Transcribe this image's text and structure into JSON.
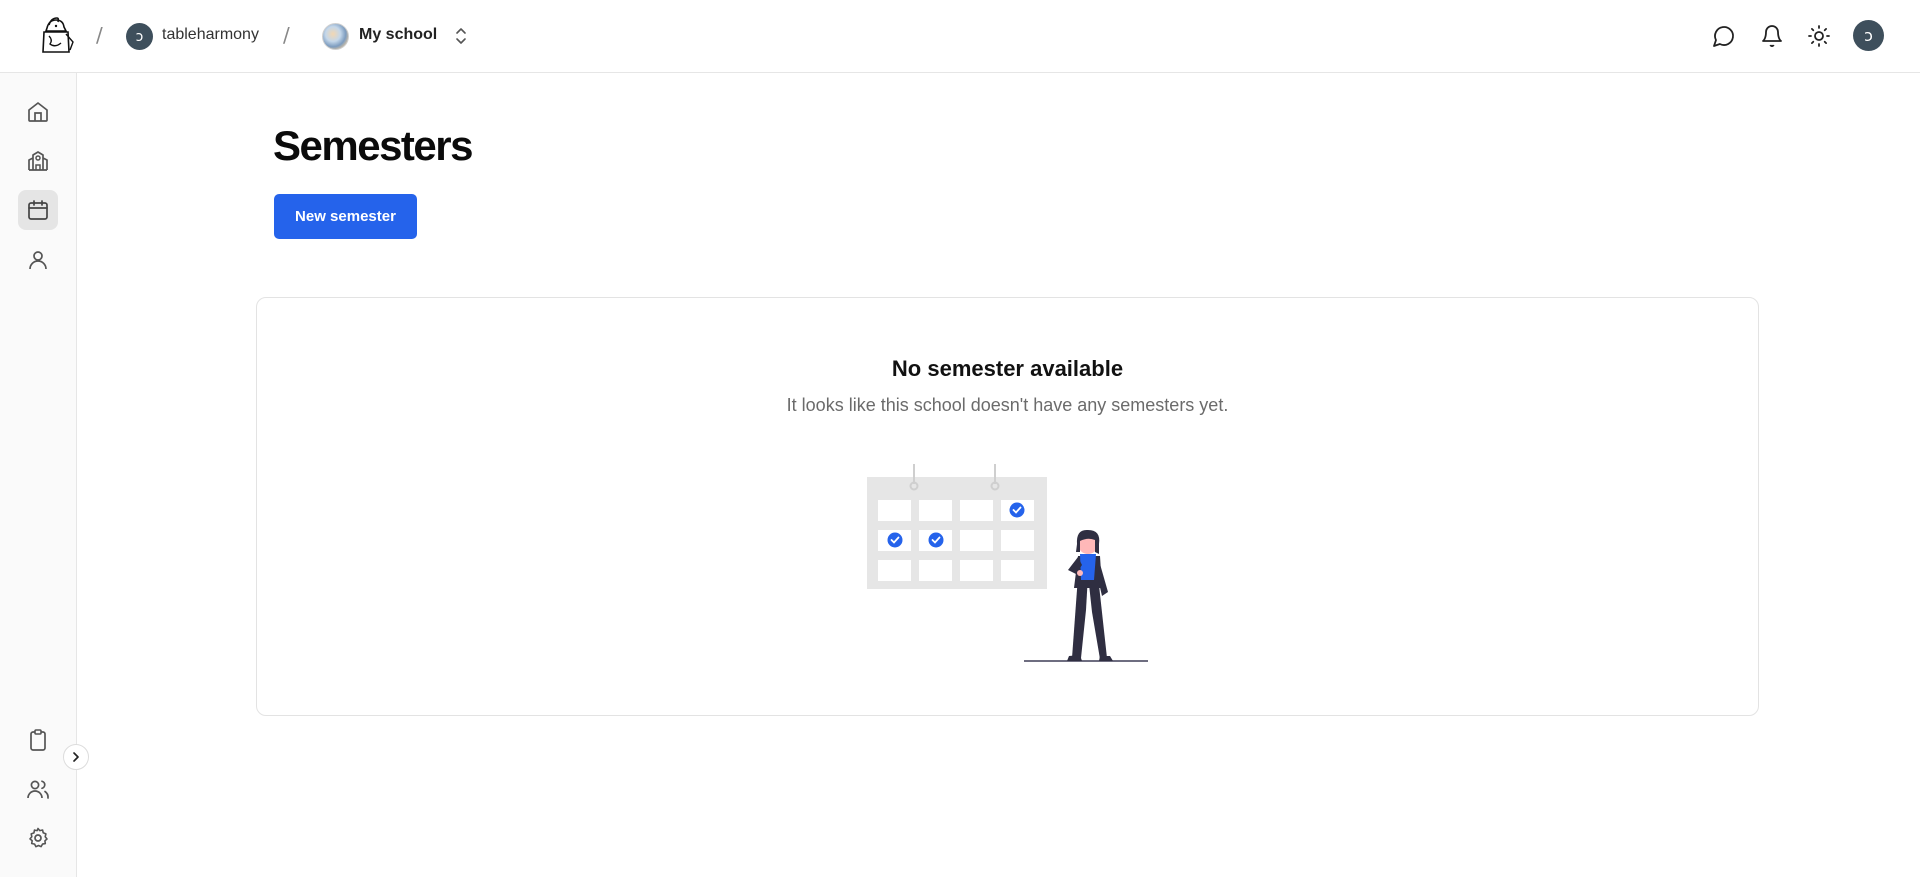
{
  "header": {
    "separator": "/",
    "user": {
      "name": "tableharmony",
      "initial": "ↄ"
    },
    "school": {
      "name": "My school"
    },
    "icons": [
      "chat-icon",
      "bell-icon",
      "sun-icon"
    ],
    "avatar_initial": "ↄ"
  },
  "sidebar": {
    "top_items": [
      "home-icon",
      "school-icon",
      "calendar-icon",
      "user-icon"
    ],
    "active_item": "calendar-icon",
    "bottom_items": [
      "clipboard-icon",
      "users-icon",
      "gear-icon"
    ]
  },
  "main": {
    "title": "Semesters",
    "new_button": "New semester",
    "empty_state": {
      "title": "No semester available",
      "description": "It looks like this school doesn't have any semesters yet."
    }
  },
  "colors": {
    "primary": "#2563eb",
    "avatar": "#3e4f5c",
    "illustration_gray": "#e6e6e6",
    "illustration_dark": "#2f2e41"
  }
}
